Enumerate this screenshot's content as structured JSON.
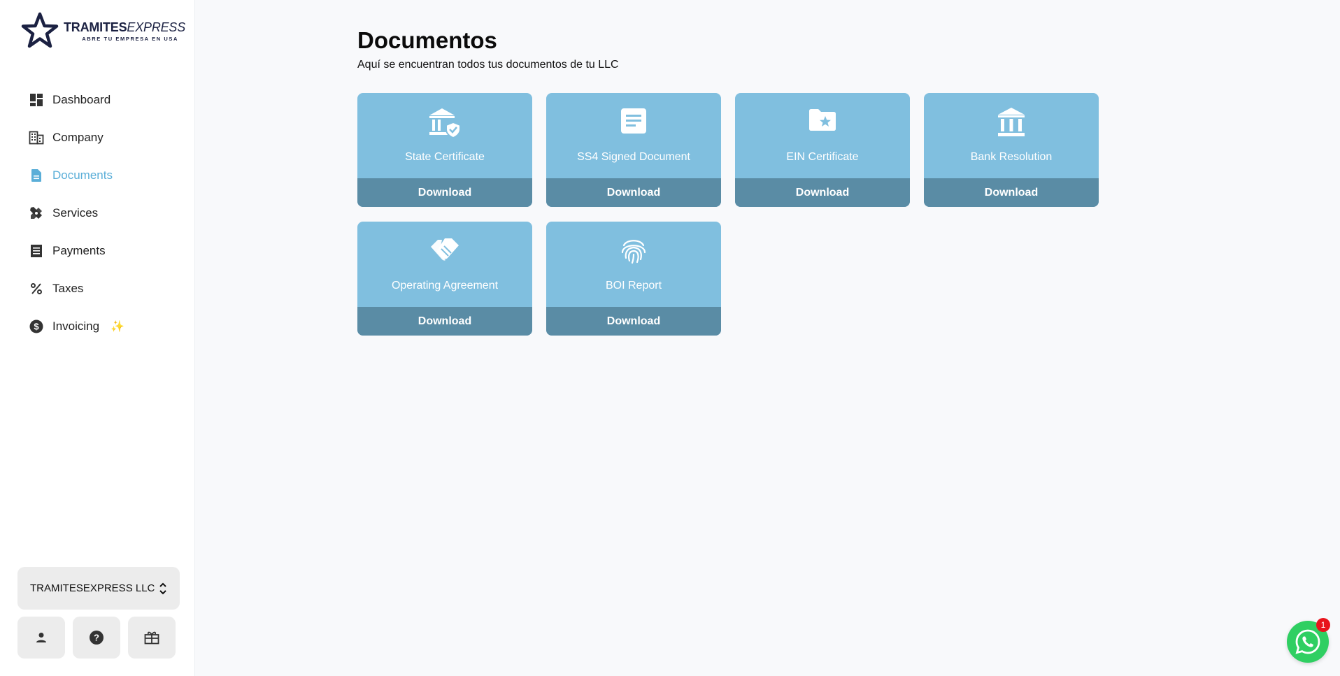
{
  "brand": {
    "name_bold": "TRAMITES",
    "name_italic": "EXPRESS",
    "tagline": "ABRE TU EMPRESA EN USA"
  },
  "colors": {
    "accent": "#5aaed8",
    "card": "#80bfdf",
    "card_footer": "#5a8ca5",
    "whatsapp": "#2fcf62",
    "badge": "#e8141c"
  },
  "sidebar": {
    "items": [
      {
        "label": "Dashboard",
        "icon": "dashboard-icon"
      },
      {
        "label": "Company",
        "icon": "building-icon"
      },
      {
        "label": "Documents",
        "icon": "document-icon",
        "active": true
      },
      {
        "label": "Services",
        "icon": "tools-icon"
      },
      {
        "label": "Payments",
        "icon": "receipt-icon"
      },
      {
        "label": "Taxes",
        "icon": "percent-icon"
      },
      {
        "label": "Invoicing",
        "icon": "dollar-circle-icon",
        "badge": "✨"
      }
    ],
    "company_selector": "TRAMITESEXPRESS LLC",
    "utility_icons": [
      "person-icon",
      "help-icon",
      "gift-icon"
    ]
  },
  "main": {
    "title": "Documentos",
    "subtitle": "Aquí se encuentran todos tus documentos de tu LLC",
    "documents": [
      {
        "title": "State Certificate",
        "action": "Download",
        "icon": "bank-shield-icon"
      },
      {
        "title": "SS4 Signed Document",
        "action": "Download",
        "icon": "document-lines-icon"
      },
      {
        "title": "EIN Certificate",
        "action": "Download",
        "icon": "folder-star-icon"
      },
      {
        "title": "Bank Resolution",
        "action": "Download",
        "icon": "bank-icon"
      },
      {
        "title": "Operating Agreement",
        "action": "Download",
        "icon": "handshake-icon"
      },
      {
        "title": "BOI Report",
        "action": "Download",
        "icon": "fingerprint-icon"
      }
    ]
  },
  "chat": {
    "icon": "whatsapp-icon",
    "notification_count": "1"
  }
}
